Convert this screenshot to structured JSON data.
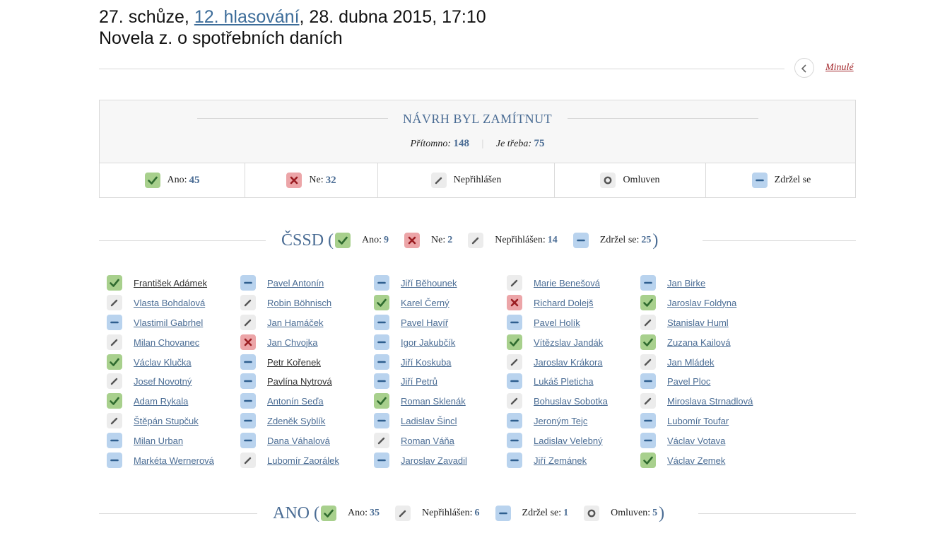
{
  "header": {
    "line1_prefix": "27. schůze, ",
    "vote_link": "12. hlasování",
    "line1_suffix": ", 28. dubna 2015, 17:10",
    "line2": "Novela z. o spotřebních daních"
  },
  "nav": {
    "previous_label": "Minulé",
    "previous_icon": "chevron-left-icon"
  },
  "result": {
    "title": "NÁVRH BYL ZAMÍTNUT",
    "present_label": "Přítomno:",
    "present_value": "148",
    "required_label": "Je třeba:",
    "required_value": "75",
    "cells": [
      {
        "type": "ano",
        "label": "Ano:",
        "value": "45"
      },
      {
        "type": "ne",
        "label": "Ne:",
        "value": "32"
      },
      {
        "type": "neprihlasen",
        "label": "Nepřihlášen",
        "value": ""
      },
      {
        "type": "omluven",
        "label": "Omluven",
        "value": ""
      },
      {
        "type": "zdrzel",
        "label": "Zdržel se",
        "value": ""
      }
    ]
  },
  "parties": [
    {
      "name": "ČSSD",
      "stats": [
        {
          "type": "ano",
          "label": "Ano:",
          "value": "9"
        },
        {
          "type": "ne",
          "label": "Ne:",
          "value": "2"
        },
        {
          "type": "neprihlasen",
          "label": "Nepřihlášen:",
          "value": "14"
        },
        {
          "type": "zdrzel",
          "label": "Zdržel se:",
          "value": "25"
        }
      ]
    },
    {
      "name": "ANO",
      "stats": [
        {
          "type": "ano",
          "label": "Ano:",
          "value": "35"
        },
        {
          "type": "neprihlasen",
          "label": "Nepřihlášen:",
          "value": "6"
        },
        {
          "type": "zdrzel",
          "label": "Zdržel se:",
          "value": "1"
        },
        {
          "type": "omluven",
          "label": "Omluven:",
          "value": "5"
        }
      ]
    }
  ],
  "members": [
    [
      {
        "name": "František Adámek",
        "vote": "ano",
        "dark": true
      },
      {
        "name": "Pavel Antonín",
        "vote": "zdrzel"
      },
      {
        "name": "Jiří Běhounek",
        "vote": "zdrzel"
      },
      {
        "name": "Marie Benešová",
        "vote": "neprihlasen"
      },
      {
        "name": "Jan Birke",
        "vote": "zdrzel"
      }
    ],
    [
      {
        "name": "Vlasta Bohdalová",
        "vote": "neprihlasen"
      },
      {
        "name": "Robin Böhnisch",
        "vote": "neprihlasen"
      },
      {
        "name": "Karel Černý",
        "vote": "ano"
      },
      {
        "name": "Richard Dolejš",
        "vote": "ne"
      },
      {
        "name": "Jaroslav Foldyna",
        "vote": "ano"
      }
    ],
    [
      {
        "name": "Vlastimil Gabrhel",
        "vote": "zdrzel"
      },
      {
        "name": "Jan Hamáček",
        "vote": "neprihlasen"
      },
      {
        "name": "Pavel Havíř",
        "vote": "zdrzel"
      },
      {
        "name": "Pavel Holík",
        "vote": "zdrzel"
      },
      {
        "name": "Stanislav Huml",
        "vote": "neprihlasen"
      }
    ],
    [
      {
        "name": "Milan Chovanec",
        "vote": "neprihlasen"
      },
      {
        "name": "Jan Chvojka",
        "vote": "ne"
      },
      {
        "name": "Igor Jakubčík",
        "vote": "zdrzel"
      },
      {
        "name": "Vítězslav Jandák",
        "vote": "ano"
      },
      {
        "name": "Zuzana Kailová",
        "vote": "ano"
      }
    ],
    [
      {
        "name": "Václav Klučka",
        "vote": "ano"
      },
      {
        "name": "Petr Kořenek",
        "vote": "zdrzel",
        "dark": true
      },
      {
        "name": "Jiří Koskuba",
        "vote": "zdrzel"
      },
      {
        "name": "Jaroslav Krákora",
        "vote": "neprihlasen"
      },
      {
        "name": "Jan Mládek",
        "vote": "neprihlasen"
      }
    ],
    [
      {
        "name": "Josef Novotný",
        "vote": "neprihlasen"
      },
      {
        "name": "Pavlína Nytrová",
        "vote": "zdrzel",
        "dark": true
      },
      {
        "name": "Jiří Petrů",
        "vote": "zdrzel"
      },
      {
        "name": "Lukáš Pleticha",
        "vote": "zdrzel"
      },
      {
        "name": "Pavel Ploc",
        "vote": "zdrzel"
      }
    ],
    [
      {
        "name": "Adam Rykala",
        "vote": "ano"
      },
      {
        "name": "Antonín Seďa",
        "vote": "zdrzel"
      },
      {
        "name": "Roman Sklenák",
        "vote": "ano"
      },
      {
        "name": "Bohuslav Sobotka",
        "vote": "neprihlasen"
      },
      {
        "name": "Miroslava Strnadlová",
        "vote": "neprihlasen"
      }
    ],
    [
      {
        "name": "Štěpán Stupčuk",
        "vote": "neprihlasen"
      },
      {
        "name": "Zdeněk Syblík",
        "vote": "zdrzel"
      },
      {
        "name": "Ladislav Šincl",
        "vote": "zdrzel"
      },
      {
        "name": "Jeroným Tejc",
        "vote": "zdrzel"
      },
      {
        "name": "Lubomír Toufar",
        "vote": "zdrzel"
      }
    ],
    [
      {
        "name": "Milan Urban",
        "vote": "zdrzel"
      },
      {
        "name": "Dana Váhalová",
        "vote": "zdrzel"
      },
      {
        "name": "Roman Váňa",
        "vote": "neprihlasen"
      },
      {
        "name": "Ladislav Velebný",
        "vote": "zdrzel"
      },
      {
        "name": "Václav Votava",
        "vote": "zdrzel"
      }
    ],
    [
      {
        "name": "Markéta Wernerová",
        "vote": "zdrzel"
      },
      {
        "name": "Lubomír Zaorálek",
        "vote": "neprihlasen"
      },
      {
        "name": "Jaroslav Zavadil",
        "vote": "zdrzel"
      },
      {
        "name": "Jiří Zemánek",
        "vote": "zdrzel"
      },
      {
        "name": "Václav Zemek",
        "vote": "ano"
      }
    ]
  ],
  "colors": {
    "accent": "#4a6c94",
    "ano": "#a8d08d",
    "ne": "#eca5a8",
    "neprihlasen": "#ececec",
    "omluven": "#ececec",
    "zdrzel": "#b9d3ee",
    "previous_link": "#a2262a"
  },
  "icons": {
    "ano": "check-icon",
    "ne": "cross-icon",
    "neprihlasen": "pencil-icon",
    "omluven": "circle-icon",
    "zdrzel": "minus-icon"
  }
}
